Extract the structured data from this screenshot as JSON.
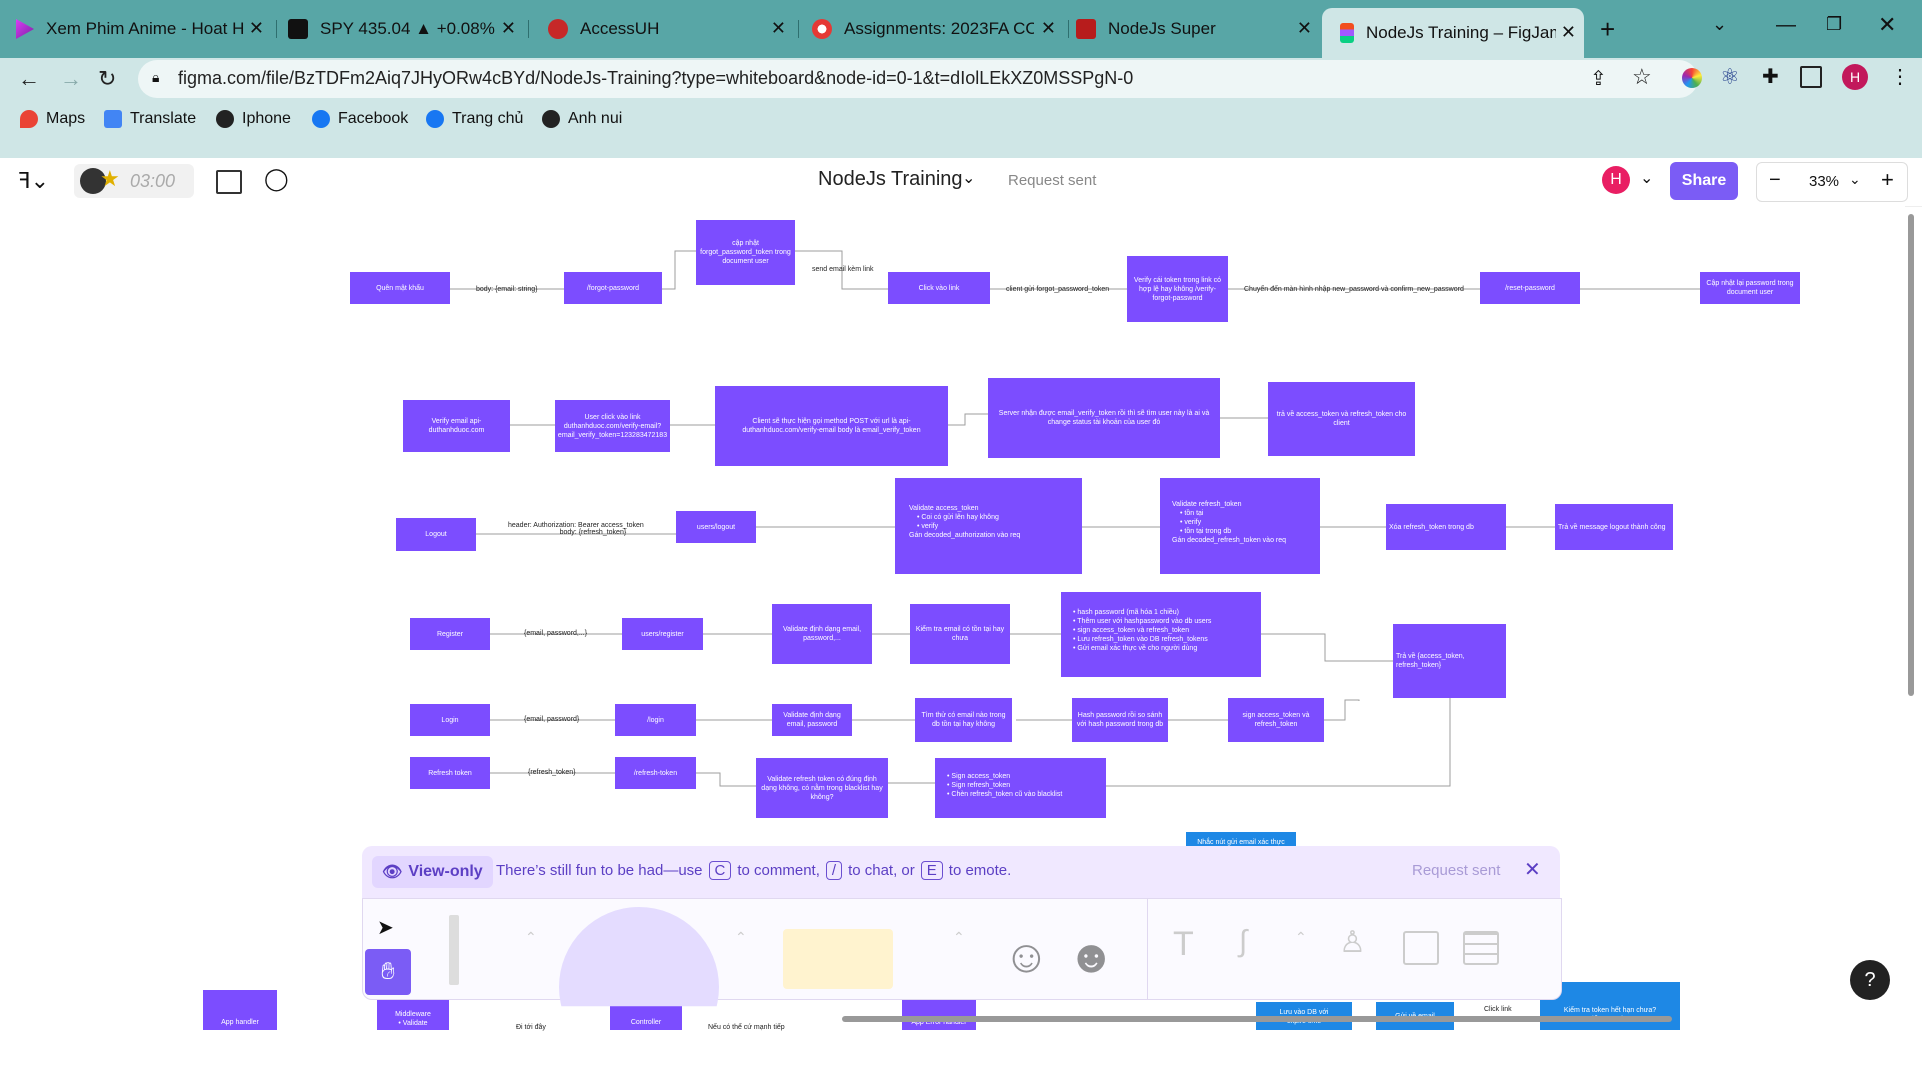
{
  "browser": {
    "tabs": [
      {
        "label": "Xem Phim Anime - Hoat H",
        "color": "#6a1b9a"
      },
      {
        "label": "SPY 435.04 ▲ +0.08% Unn",
        "color": "#111111"
      },
      {
        "label": "AccessUH",
        "color": "#c62828"
      },
      {
        "label": "Assignments: 2023FA COS",
        "color": "#c62828"
      },
      {
        "label": "NodeJs Super",
        "color": "#b71c1c"
      },
      {
        "label": "NodeJs Training – FigJam",
        "color": "#a259ff"
      }
    ],
    "url": "figma.com/file/BzTDFm2Aiq7JHyORw4cBYd/NodeJs-Training?type=whiteboard&node-id=0-1&t=dIolLEkXZ0MSSPgN-0",
    "bookmarks": [
      "Maps",
      "Translate",
      "Iphone",
      "Facebook",
      "Trang chủ",
      "Anh nui"
    ],
    "profile_initial": "H"
  },
  "figma": {
    "timer": "03:00",
    "file_title": "NodeJs Training",
    "status": "Request sent",
    "user_initial": "H",
    "share_label": "Share",
    "zoom": "33%"
  },
  "viewbar": {
    "badge": "View-only",
    "text_a": "There’s still fun to be had—use",
    "key_c": "C",
    "text_b": "to comment,",
    "key_slash": "/",
    "text_c": "to chat, or",
    "key_e": "E",
    "text_d": "to emote.",
    "status": "Request sent"
  },
  "board": {
    "r1": {
      "a": "Quên mật khẩu",
      "e1": "body: {email: string}",
      "b": "/forgot-password",
      "c": "cập nhật forgot_password_token trong document user",
      "e2": "send email kèm link",
      "d": "Click vào link",
      "e3": "client gửi forgot_password_token",
      "f": "Verify cái token trong link có hợp lệ hay không /verify-forgot-password",
      "e4": "Chuyển đến màn hình nhập new_password và confirm_new_password",
      "g": "/reset-password",
      "h": "Cập nhật lại password trong document user"
    },
    "r2": {
      "a": "Verify email api-duthanhduoc.com",
      "b": "User click vào link duthanhduoc.com/verify-email?email_verify_token=123283472183",
      "c": "Client sẽ thực hiện gọi method POST với url là api-duthanhduoc.com/verify-email body là email_verify_token",
      "d": "Server nhận được email_verify_token rồi thì sẽ tìm user này là ai và change status tài khoản của user đó",
      "e": "trả về access_token và refresh_token cho client"
    },
    "r3": {
      "a": "Logout",
      "e1": "header: Authorization: Bearer access_token",
      "e1b": "body: {refresh_token}",
      "b": "users/logout",
      "c_title": "Validate access_token",
      "c_items": [
        "Coi có gửi lên hay không",
        "verify"
      ],
      "c_foot": "Gán decoded_authorization vào req",
      "d_title": "Validate refresh_token",
      "d_items": [
        "tồn tại",
        "verify",
        "tồn tại trong db"
      ],
      "d_foot": "Gán decoded_refresh_token vào req",
      "e": "Xóa refresh_token trong db",
      "f": "Trả về message logout thành công"
    },
    "r4": {
      "a": "Register",
      "e1": "{email, password,...}",
      "b": "users/register",
      "c": "Validate định dạng email, password,...",
      "d": "Kiểm tra email có tồn tại hay chưa",
      "e_items": [
        "hash password (mã hóa 1 chiều)",
        "Thêm user với hashpassword vào db users",
        "sign access_token và refresh_token",
        "Lưu refresh_token vào DB refresh_tokens",
        "Gửi email xác thực về cho người dùng"
      ],
      "f": "Trả về {access_token, refresh_token}"
    },
    "r5": {
      "a": "Login",
      "e1": "{email, password}",
      "b": "/login",
      "c": "Validate định dạng email, password",
      "d": "Tìm thử có email nào trong db tồn tại hay không",
      "e": "Hash password rồi so sánh với hash password trong db",
      "f": "sign access_token và refresh_token"
    },
    "r6": {
      "a": "Refresh token",
      "e1": "{refresh_token}",
      "b": "/refresh-token",
      "c": "Validate refresh token có đúng định dạng không, có nằm trong blacklist hay không?",
      "d_items": [
        "Sign access_token",
        "Sign refresh_token",
        "Chèn refresh_token cũ vào blacklist"
      ]
    },
    "bottom": {
      "blue_mid": "Nhắc nút gửi email xác thực",
      "b1": "App handler",
      "b2": "Middleware",
      "b2b": "• Validate",
      "e1": "Đi tới đây",
      "b3": "Controller",
      "e2": "Nếu có thể cứ mạnh tiếp",
      "b4": "App Error handler",
      "c1": "Lưu vào DB với",
      "c1b": "expire time",
      "c2": "Gửi về email",
      "e3": "Click link",
      "c3": "Kiểm tra token hết hạn chưa?",
      "c3b": "Kiểm tra token"
    }
  },
  "colors": {
    "purple": "#7c4dff",
    "blue": "#1e88e5",
    "share": "#7b5cf5",
    "tabbar": "#58a6a6"
  }
}
